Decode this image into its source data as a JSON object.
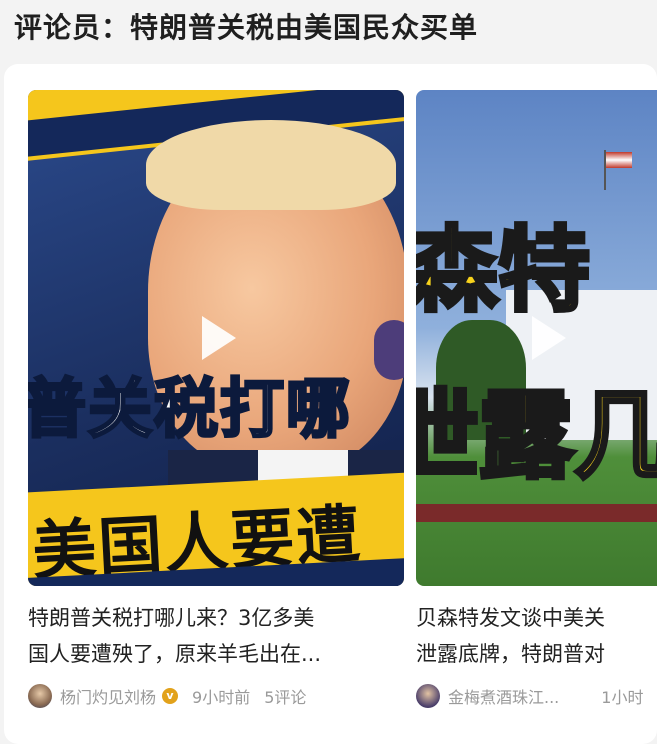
{
  "header": {
    "title": "评论员：特朗普关税由美国民众买单"
  },
  "items": [
    {
      "overlay_line1": "普关税打哪",
      "overlay_line2": "美国人要遭",
      "caption_line1": "特朗普关税打哪儿来？3亿多美",
      "caption_line2": "国人要遭殃了，原来羊毛出在...",
      "author": "杨门灼见刘杨",
      "verified_mark": "v",
      "time": "9小时前",
      "comments": "5评论"
    },
    {
      "overlay_line1": "森特",
      "overlay_line2": "泄露几",
      "caption_line1": "贝森特发文谈中美关",
      "caption_line2": "泄露底牌，特朗普对",
      "author": "金梅煮酒珠江...",
      "time": "1小时"
    }
  ],
  "colors": {
    "accent_yellow": "#f5c61c",
    "thumb1_bg": "#1e3d7a",
    "thumb2_sky": "#6c8fc9",
    "thumb2_lawn": "#4f8f3a"
  },
  "icons": [
    "play-icon",
    "verified-icon",
    "avatar"
  ]
}
